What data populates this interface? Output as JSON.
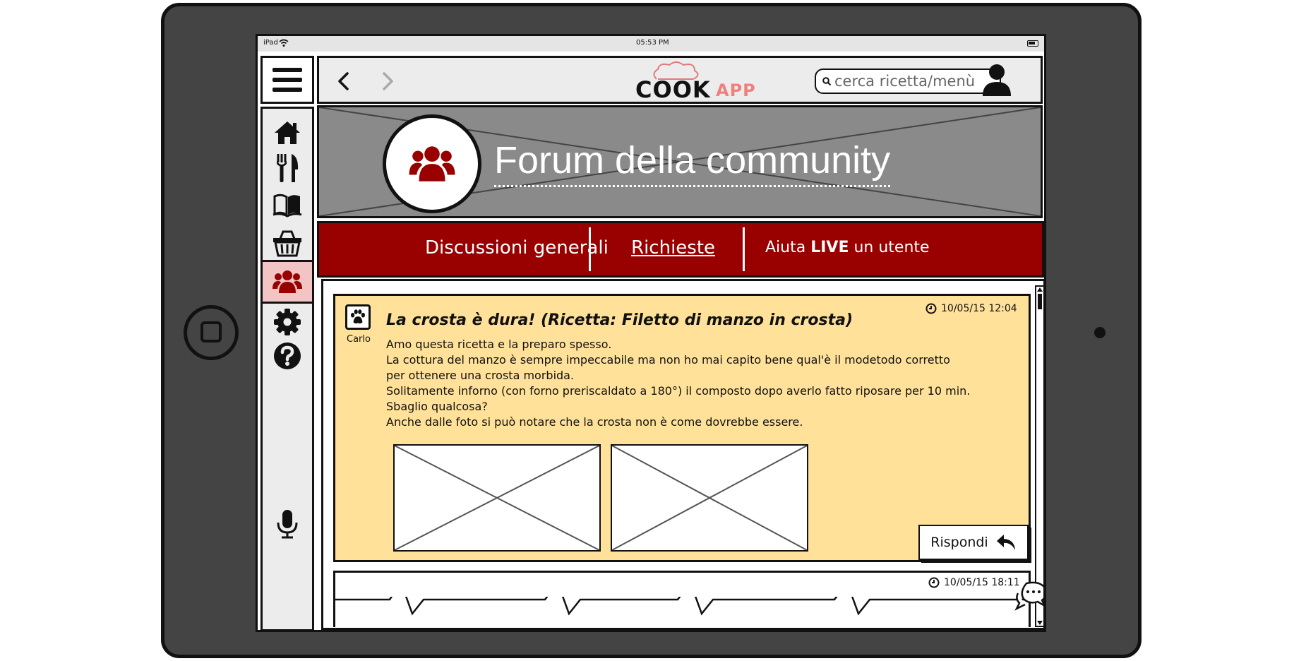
{
  "device": {
    "label": "iPad",
    "time": "05:53 PM"
  },
  "app": {
    "logo_main": "COOK",
    "logo_accent": "APP"
  },
  "search": {
    "placeholder": "cerca ricetta/menù"
  },
  "sidebar": {
    "items": [
      {
        "name": "home"
      },
      {
        "name": "ricette"
      },
      {
        "name": "libro"
      },
      {
        "name": "spesa"
      },
      {
        "name": "community",
        "active": true
      },
      {
        "name": "impostazioni"
      },
      {
        "name": "aiuto"
      },
      {
        "name": "microfono"
      }
    ]
  },
  "hero": {
    "title": "Forum della community"
  },
  "tabs": {
    "items": [
      {
        "label": "Discussioni generali"
      },
      {
        "label": "Richieste",
        "active": true
      },
      {
        "label_prefix": "Aiuta ",
        "label_bold": "LIVE",
        "label_suffix": " un utente"
      }
    ]
  },
  "posts": [
    {
      "author": "Carlo",
      "timestamp": "10/05/15 12:04",
      "title": "La crosta è dura! (Ricetta: Filetto di manzo in crosta)",
      "body": [
        "Amo questa ricetta e la preparo spesso.",
        "La cottura del manzo è sempre impeccabile ma non ho mai capito bene qual'è il modetodo corretto",
        "per ottenere una crosta morbida.",
        "Solitamente inforno (con forno preriscaldato a 180°) il composto dopo averlo fatto riposare per 10 min.",
        "Sbaglio qualcosa?",
        "Anche dalle foto si può notare che la crosta non è come dovrebbe essere."
      ],
      "reply_label": "Rispondi"
    },
    {
      "timestamp": "10/05/15 18:11"
    }
  ],
  "colors": {
    "accent_red": "#990000",
    "active_item_bg": "#f2c4c4",
    "post_bg": "#ffe199",
    "logo_accent": "#f08080"
  }
}
